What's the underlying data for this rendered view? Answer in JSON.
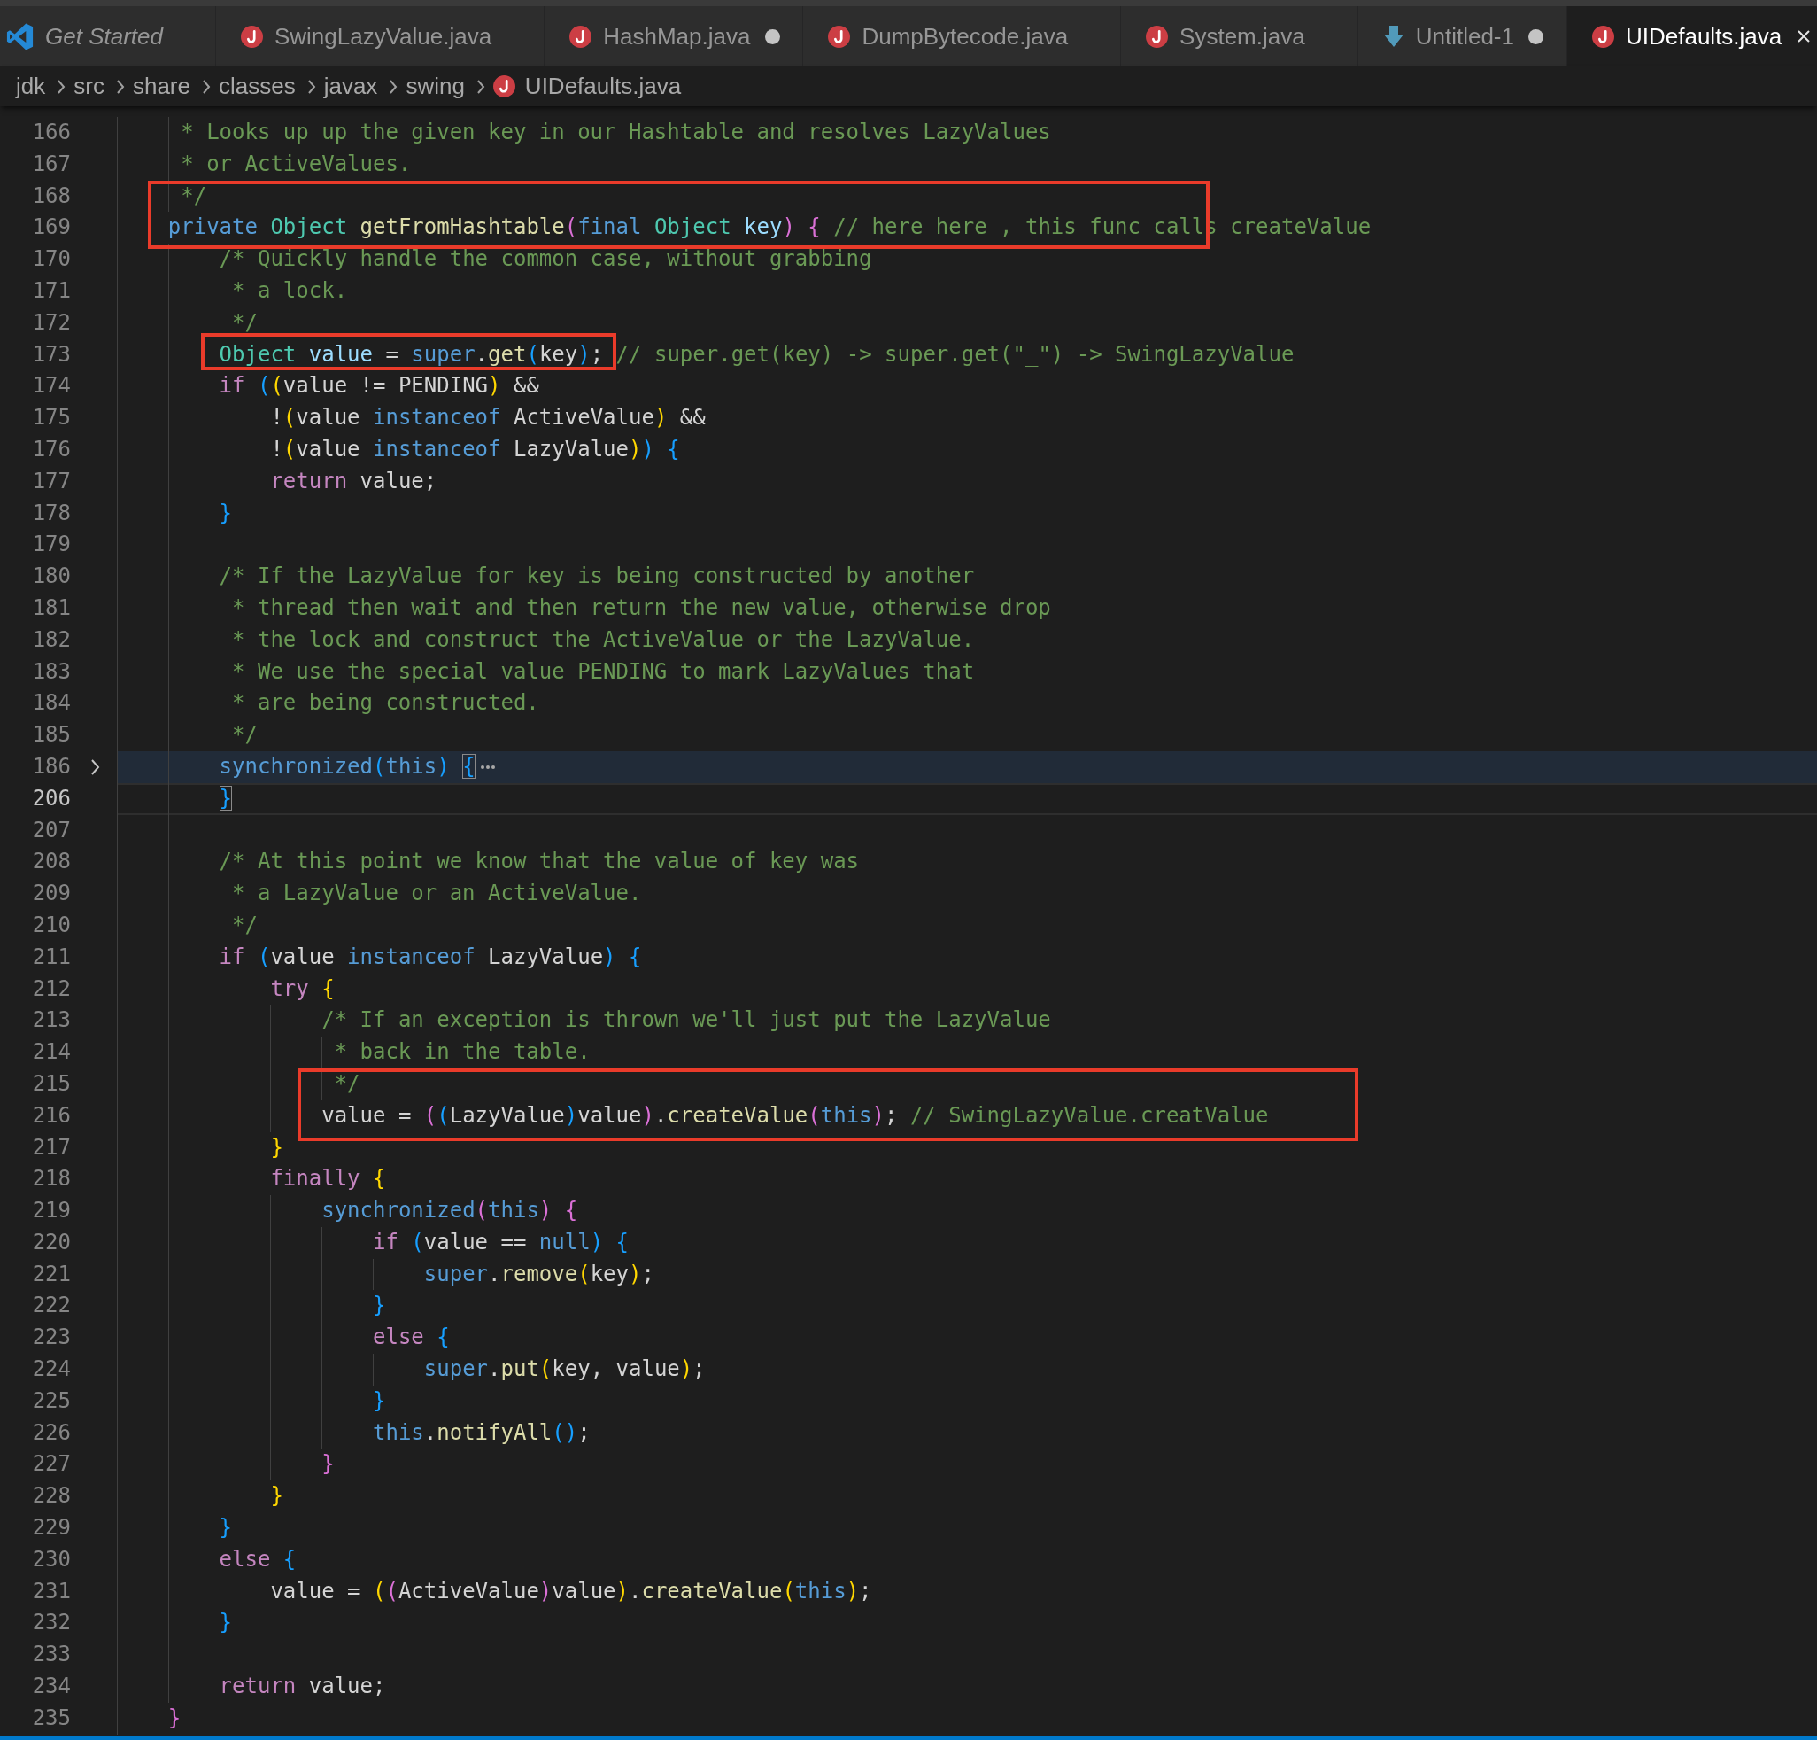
{
  "tabs": [
    {
      "label": "Get Started",
      "kind": "welcome",
      "selected": false,
      "preview": true,
      "modified": false
    },
    {
      "label": "SwingLazyValue.java",
      "kind": "java",
      "selected": false,
      "preview": false,
      "modified": false
    },
    {
      "label": "HashMap.java",
      "kind": "java",
      "selected": false,
      "preview": false,
      "modified": true
    },
    {
      "label": "DumpBytecode.java",
      "kind": "java",
      "selected": false,
      "preview": false,
      "modified": false
    },
    {
      "label": "System.java",
      "kind": "java",
      "selected": false,
      "preview": false,
      "modified": false
    },
    {
      "label": "Untitled-1",
      "kind": "untitled",
      "selected": false,
      "preview": false,
      "modified": true
    },
    {
      "label": "UIDefaults.java",
      "kind": "java",
      "selected": true,
      "preview": false,
      "modified": false
    }
  ],
  "breadcrumb": [
    {
      "label": "jdk",
      "kind": "folder"
    },
    {
      "label": "src",
      "kind": "folder"
    },
    {
      "label": "share",
      "kind": "folder"
    },
    {
      "label": "classes",
      "kind": "folder"
    },
    {
      "label": "javax",
      "kind": "folder"
    },
    {
      "label": "swing",
      "kind": "folder"
    },
    {
      "label": "UIDefaults.java",
      "kind": "java"
    }
  ],
  "editor": {
    "lines": [
      {
        "number": "166",
        "boxed": false,
        "folded": false,
        "current": false,
        "tokens": [
          {
            "kind": "comment",
            "text": "     * Looks up up the given key in our Hashtable and resolves LazyValues"
          }
        ]
      },
      {
        "number": "167",
        "boxed": false,
        "folded": false,
        "current": false,
        "tokens": [
          {
            "kind": "comment",
            "text": "     * or ActiveValues."
          }
        ]
      },
      {
        "number": "168",
        "boxed": true,
        "folded": false,
        "current": false,
        "tokens": [
          {
            "kind": "comment",
            "text": "     */"
          }
        ]
      },
      {
        "number": "169",
        "boxed": true,
        "folded": false,
        "current": false,
        "tokens": [
          {
            "kind": "keyword",
            "text": "    private "
          },
          {
            "kind": "type",
            "text": "Object "
          },
          {
            "kind": "function",
            "text": "getFromHashtable"
          },
          {
            "kind": "bracket2",
            "text": "("
          },
          {
            "kind": "keyword",
            "text": "final "
          },
          {
            "kind": "type",
            "text": "Object "
          },
          {
            "kind": "variable",
            "text": "key"
          },
          {
            "kind": "bracket2",
            "text": ")"
          },
          {
            "kind": "bracket2",
            "text": " {"
          },
          {
            "kind": "comment",
            "text": " // here here , this func calls createValue"
          }
        ]
      },
      {
        "number": "170",
        "boxed": false,
        "folded": false,
        "current": false,
        "tokens": [
          {
            "kind": "comment",
            "text": "        /* Quickly handle the common case, without grabbing"
          }
        ]
      },
      {
        "number": "171",
        "boxed": false,
        "folded": false,
        "current": false,
        "tokens": [
          {
            "kind": "comment",
            "text": "         * a lock."
          }
        ]
      },
      {
        "number": "172",
        "boxed": false,
        "folded": false,
        "current": false,
        "tokens": [
          {
            "kind": "comment",
            "text": "         */"
          }
        ]
      },
      {
        "number": "173",
        "boxed": true,
        "folded": false,
        "current": false,
        "tokens": [
          {
            "kind": "type",
            "text": "        Object "
          },
          {
            "kind": "variable",
            "text": "value"
          },
          {
            "kind": "plain",
            "text": " = "
          },
          {
            "kind": "keyword",
            "text": "super"
          },
          {
            "kind": "plain",
            "text": "."
          },
          {
            "kind": "function",
            "text": "get"
          },
          {
            "kind": "bracket3",
            "text": "("
          },
          {
            "kind": "plain",
            "text": "key"
          },
          {
            "kind": "bracket3",
            "text": ")"
          },
          {
            "kind": "plain",
            "text": "; "
          },
          {
            "kind": "comment",
            "text": "// super.get(key) -> super.get(\"_\") -> SwingLazyValue"
          }
        ]
      },
      {
        "number": "174",
        "boxed": false,
        "folded": false,
        "current": false,
        "tokens": [
          {
            "kind": "control",
            "text": "        if "
          },
          {
            "kind": "bracket3",
            "text": "("
          },
          {
            "kind": "bracket1",
            "text": "("
          },
          {
            "kind": "plain",
            "text": "value != PENDING"
          },
          {
            "kind": "bracket1",
            "text": ")"
          },
          {
            "kind": "plain",
            "text": " &&"
          }
        ]
      },
      {
        "number": "175",
        "boxed": false,
        "folded": false,
        "current": false,
        "tokens": [
          {
            "kind": "plain",
            "text": "            !"
          },
          {
            "kind": "bracket1",
            "text": "("
          },
          {
            "kind": "plain",
            "text": "value "
          },
          {
            "kind": "keyword",
            "text": "instanceof"
          },
          {
            "kind": "plain",
            "text": " ActiveValue"
          },
          {
            "kind": "bracket1",
            "text": ")"
          },
          {
            "kind": "plain",
            "text": " &&"
          }
        ]
      },
      {
        "number": "176",
        "boxed": false,
        "folded": false,
        "current": false,
        "tokens": [
          {
            "kind": "plain",
            "text": "            !"
          },
          {
            "kind": "bracket1",
            "text": "("
          },
          {
            "kind": "plain",
            "text": "value "
          },
          {
            "kind": "keyword",
            "text": "instanceof"
          },
          {
            "kind": "plain",
            "text": " LazyValue"
          },
          {
            "kind": "bracket1",
            "text": ")"
          },
          {
            "kind": "bracket3",
            "text": ")"
          },
          {
            "kind": "bracket3",
            "text": " {"
          }
        ]
      },
      {
        "number": "177",
        "boxed": false,
        "folded": false,
        "current": false,
        "tokens": [
          {
            "kind": "control",
            "text": "            return"
          },
          {
            "kind": "plain",
            "text": " value;"
          }
        ]
      },
      {
        "number": "178",
        "boxed": false,
        "folded": false,
        "current": false,
        "tokens": [
          {
            "kind": "bracket3",
            "text": "        }"
          }
        ]
      },
      {
        "number": "179",
        "boxed": false,
        "folded": false,
        "current": false
      },
      {
        "number": "180",
        "boxed": false,
        "folded": false,
        "current": false,
        "tokens": [
          {
            "kind": "comment",
            "text": "        /* If the LazyValue for key is being constructed by another"
          }
        ]
      },
      {
        "number": "181",
        "boxed": false,
        "folded": false,
        "current": false,
        "tokens": [
          {
            "kind": "comment",
            "text": "         * thread then wait and then return the new value, otherwise drop"
          }
        ]
      },
      {
        "number": "182",
        "boxed": false,
        "folded": false,
        "current": false,
        "tokens": [
          {
            "kind": "comment",
            "text": "         * the lock and construct the ActiveValue or the LazyValue."
          }
        ]
      },
      {
        "number": "183",
        "boxed": false,
        "folded": false,
        "current": false,
        "tokens": [
          {
            "kind": "comment",
            "text": "         * We use the special value PENDING to mark LazyValues that"
          }
        ]
      },
      {
        "number": "184",
        "boxed": false,
        "folded": false,
        "current": false,
        "tokens": [
          {
            "kind": "comment",
            "text": "         * are being constructed."
          }
        ]
      },
      {
        "number": "185",
        "boxed": false,
        "folded": false,
        "current": false,
        "tokens": [
          {
            "kind": "comment",
            "text": "         */"
          }
        ]
      },
      {
        "number": "186",
        "boxed": false,
        "folded": true,
        "current": false,
        "tokens": [
          {
            "kind": "keyword",
            "text": "        synchronized"
          },
          {
            "kind": "bracket3",
            "text": "("
          },
          {
            "kind": "keyword",
            "text": "this"
          },
          {
            "kind": "bracket3",
            "text": ") "
          },
          {
            "kind": "matched",
            "text": "{"
          }
        ]
      },
      {
        "number": "206",
        "boxed": false,
        "folded": false,
        "current": true,
        "tokens": [
          {
            "kind": "matched",
            "text": "        }"
          }
        ]
      },
      {
        "number": "207",
        "boxed": false,
        "folded": false,
        "current": false
      },
      {
        "number": "208",
        "boxed": false,
        "folded": false,
        "current": false,
        "tokens": [
          {
            "kind": "comment",
            "text": "        /* At this point we know that the value of key was"
          }
        ]
      },
      {
        "number": "209",
        "boxed": false,
        "folded": false,
        "current": false,
        "tokens": [
          {
            "kind": "comment",
            "text": "         * a LazyValue or an ActiveValue."
          }
        ]
      },
      {
        "number": "210",
        "boxed": false,
        "folded": false,
        "current": false,
        "tokens": [
          {
            "kind": "comment",
            "text": "         */"
          }
        ]
      },
      {
        "number": "211",
        "boxed": false,
        "folded": false,
        "current": false,
        "tokens": [
          {
            "kind": "control",
            "text": "        if "
          },
          {
            "kind": "bracket3",
            "text": "("
          },
          {
            "kind": "plain",
            "text": "value "
          },
          {
            "kind": "keyword",
            "text": "instanceof"
          },
          {
            "kind": "plain",
            "text": " LazyValue"
          },
          {
            "kind": "bracket3",
            "text": ")"
          },
          {
            "kind": "bracket3",
            "text": " {"
          }
        ]
      },
      {
        "number": "212",
        "boxed": false,
        "folded": false,
        "current": false,
        "tokens": [
          {
            "kind": "control",
            "text": "            try "
          },
          {
            "kind": "bracket1",
            "text": "{"
          }
        ]
      },
      {
        "number": "213",
        "boxed": false,
        "folded": false,
        "current": false,
        "tokens": [
          {
            "kind": "comment",
            "text": "                /* If an exception is thrown we'll just put the LazyValue"
          }
        ]
      },
      {
        "number": "214",
        "boxed": false,
        "folded": false,
        "current": false,
        "tokens": [
          {
            "kind": "comment",
            "text": "                 * back in the table."
          }
        ]
      },
      {
        "number": "215",
        "boxed": true,
        "folded": false,
        "current": false,
        "tokens": [
          {
            "kind": "comment",
            "text": "                 */"
          }
        ]
      },
      {
        "number": "216",
        "boxed": true,
        "folded": false,
        "current": false,
        "tokens": [
          {
            "kind": "plain",
            "text": "                value = "
          },
          {
            "kind": "bracket2",
            "text": "("
          },
          {
            "kind": "bracket3",
            "text": "("
          },
          {
            "kind": "plain",
            "text": "LazyValue"
          },
          {
            "kind": "bracket3",
            "text": ")"
          },
          {
            "kind": "plain",
            "text": "value"
          },
          {
            "kind": "bracket2",
            "text": ")"
          },
          {
            "kind": "plain",
            "text": "."
          },
          {
            "kind": "function",
            "text": "createValue"
          },
          {
            "kind": "bracket2",
            "text": "("
          },
          {
            "kind": "keyword",
            "text": "this"
          },
          {
            "kind": "bracket2",
            "text": ")"
          },
          {
            "kind": "plain",
            "text": "; "
          },
          {
            "kind": "comment",
            "text": "// SwingLazyValue.creatValue"
          }
        ]
      },
      {
        "number": "217",
        "boxed": false,
        "folded": false,
        "current": false,
        "tokens": [
          {
            "kind": "bracket1",
            "text": "            }"
          }
        ]
      },
      {
        "number": "218",
        "boxed": false,
        "folded": false,
        "current": false,
        "tokens": [
          {
            "kind": "control",
            "text": "            finally "
          },
          {
            "kind": "bracket1",
            "text": "{"
          }
        ]
      },
      {
        "number": "219",
        "boxed": false,
        "folded": false,
        "current": false,
        "tokens": [
          {
            "kind": "keyword",
            "text": "                synchronized"
          },
          {
            "kind": "bracket2",
            "text": "("
          },
          {
            "kind": "keyword",
            "text": "this"
          },
          {
            "kind": "bracket2",
            "text": ")"
          },
          {
            "kind": "bracket2",
            "text": " {"
          }
        ]
      },
      {
        "number": "220",
        "boxed": false,
        "folded": false,
        "current": false,
        "tokens": [
          {
            "kind": "control",
            "text": "                    if "
          },
          {
            "kind": "bracket3",
            "text": "("
          },
          {
            "kind": "plain",
            "text": "value == "
          },
          {
            "kind": "keyword",
            "text": "null"
          },
          {
            "kind": "bracket3",
            "text": ")"
          },
          {
            "kind": "bracket3",
            "text": " {"
          }
        ]
      },
      {
        "number": "221",
        "boxed": false,
        "folded": false,
        "current": false,
        "tokens": [
          {
            "kind": "keyword",
            "text": "                        super"
          },
          {
            "kind": "plain",
            "text": "."
          },
          {
            "kind": "function",
            "text": "remove"
          },
          {
            "kind": "bracket1",
            "text": "("
          },
          {
            "kind": "plain",
            "text": "key"
          },
          {
            "kind": "bracket1",
            "text": ")"
          },
          {
            "kind": "plain",
            "text": ";"
          }
        ]
      },
      {
        "number": "222",
        "boxed": false,
        "folded": false,
        "current": false,
        "tokens": [
          {
            "kind": "bracket3",
            "text": "                    }"
          }
        ]
      },
      {
        "number": "223",
        "boxed": false,
        "folded": false,
        "current": false,
        "tokens": [
          {
            "kind": "control",
            "text": "                    else "
          },
          {
            "kind": "bracket3",
            "text": "{"
          }
        ]
      },
      {
        "number": "224",
        "boxed": false,
        "folded": false,
        "current": false,
        "tokens": [
          {
            "kind": "keyword",
            "text": "                        super"
          },
          {
            "kind": "plain",
            "text": "."
          },
          {
            "kind": "function",
            "text": "put"
          },
          {
            "kind": "bracket1",
            "text": "("
          },
          {
            "kind": "plain",
            "text": "key, value"
          },
          {
            "kind": "bracket1",
            "text": ")"
          },
          {
            "kind": "plain",
            "text": ";"
          }
        ]
      },
      {
        "number": "225",
        "boxed": false,
        "folded": false,
        "current": false,
        "tokens": [
          {
            "kind": "bracket3",
            "text": "                    }"
          }
        ]
      },
      {
        "number": "226",
        "boxed": false,
        "folded": false,
        "current": false,
        "tokens": [
          {
            "kind": "keyword",
            "text": "                    this"
          },
          {
            "kind": "plain",
            "text": "."
          },
          {
            "kind": "function",
            "text": "notifyAll"
          },
          {
            "kind": "bracket3",
            "text": "()"
          },
          {
            "kind": "plain",
            "text": ";"
          }
        ]
      },
      {
        "number": "227",
        "boxed": false,
        "folded": false,
        "current": false,
        "tokens": [
          {
            "kind": "bracket2",
            "text": "                }"
          }
        ]
      },
      {
        "number": "228",
        "boxed": false,
        "folded": false,
        "current": false,
        "tokens": [
          {
            "kind": "bracket1",
            "text": "            }"
          }
        ]
      },
      {
        "number": "229",
        "boxed": false,
        "folded": false,
        "current": false,
        "tokens": [
          {
            "kind": "bracket3",
            "text": "        }"
          }
        ]
      },
      {
        "number": "230",
        "boxed": false,
        "folded": false,
        "current": false,
        "tokens": [
          {
            "kind": "control",
            "text": "        else "
          },
          {
            "kind": "bracket3",
            "text": "{"
          }
        ]
      },
      {
        "number": "231",
        "boxed": false,
        "folded": false,
        "current": false,
        "tokens": [
          {
            "kind": "plain",
            "text": "            value = "
          },
          {
            "kind": "bracket1",
            "text": "("
          },
          {
            "kind": "bracket2",
            "text": "("
          },
          {
            "kind": "plain",
            "text": "ActiveValue"
          },
          {
            "kind": "bracket2",
            "text": ")"
          },
          {
            "kind": "plain",
            "text": "value"
          },
          {
            "kind": "bracket1",
            "text": ")"
          },
          {
            "kind": "plain",
            "text": "."
          },
          {
            "kind": "function",
            "text": "createValue"
          },
          {
            "kind": "bracket1",
            "text": "("
          },
          {
            "kind": "keyword",
            "text": "this"
          },
          {
            "kind": "bracket1",
            "text": ")"
          },
          {
            "kind": "plain",
            "text": ";"
          }
        ]
      },
      {
        "number": "232",
        "boxed": false,
        "folded": false,
        "current": false,
        "tokens": [
          {
            "kind": "bracket3",
            "text": "        }"
          }
        ]
      },
      {
        "number": "233",
        "boxed": false,
        "folded": false,
        "current": false
      },
      {
        "number": "234",
        "boxed": false,
        "folded": false,
        "current": false,
        "tokens": [
          {
            "kind": "control",
            "text": "        return"
          },
          {
            "kind": "plain",
            "text": " value;"
          }
        ]
      },
      {
        "number": "235",
        "boxed": false,
        "folded": false,
        "current": false,
        "tokens": [
          {
            "kind": "bracket2",
            "text": "    }"
          }
        ]
      }
    ]
  }
}
